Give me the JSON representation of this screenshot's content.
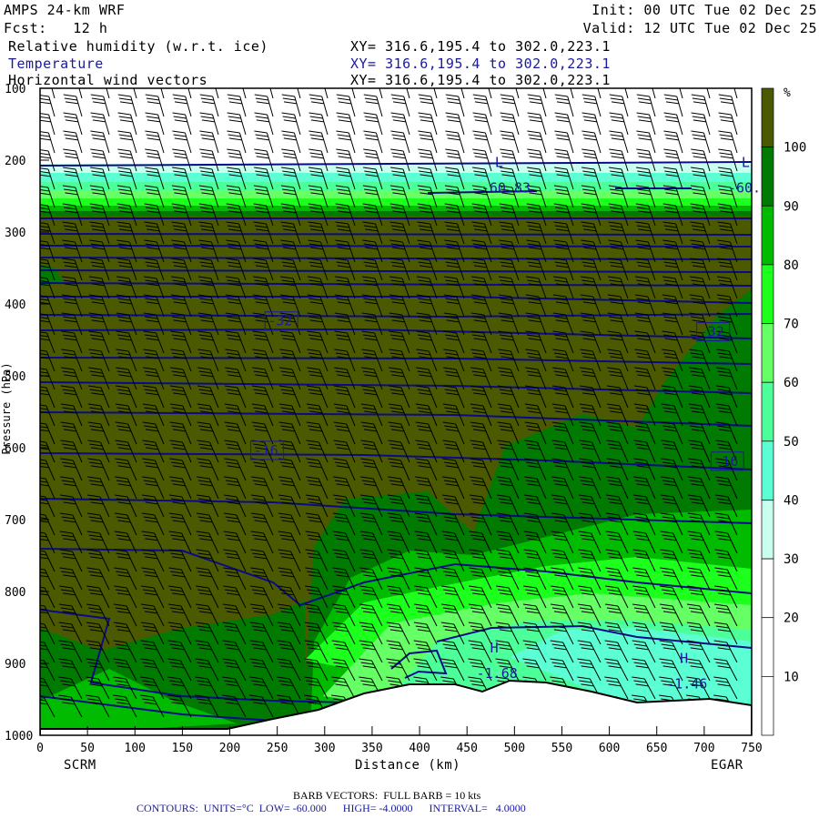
{
  "header": {
    "model": "AMPS 24-km WRF",
    "init": "Init: 00 UTC Tue 02 Dec 25",
    "fcst": "Fcst:   12 h",
    "valid": "Valid: 12 UTC Tue 02 Dec 25",
    "fields": [
      {
        "name": "Relative humidity (w.r.t. ice)",
        "xy": "XY= 316.6,195.4 to 302.0,223.1",
        "color": "#000000"
      },
      {
        "name": "Temperature",
        "xy": "XY= 316.6,195.4 to 302.0,223.1",
        "color": "#1a1a9a"
      },
      {
        "name": "Horizontal wind vectors",
        "xy": "XY= 316.6,195.4 to 302.0,223.1",
        "color": "#000000"
      }
    ]
  },
  "footer": {
    "barb": "BARB VECTORS:  FULL BARB = 10 kts",
    "contours": "CONTOURS:  UNITS=°C  LOW= -60.000      HIGH= -4.0000      INTERVAL=   4.0000"
  },
  "chart_data": {
    "type": "heatmap",
    "title": "Cross-section: RH (ice), Temperature, Wind",
    "xlabel": "Distance (km)",
    "ylabel": "Pressure (hPa)",
    "x_ticks": [
      "0",
      "50",
      "100",
      "150",
      "200",
      "250",
      "300",
      "350",
      "400",
      "450",
      "500",
      "550",
      "600",
      "650",
      "700",
      "750"
    ],
    "xlim": [
      0,
      750
    ],
    "y_ticks": [
      "100",
      "200",
      "300",
      "400",
      "500",
      "600",
      "700",
      "800",
      "900",
      "1000"
    ],
    "ylim": [
      1000,
      100
    ],
    "endpoints": {
      "left": "SCRM",
      "right": "EGAR"
    },
    "colorbar": {
      "unit": "%",
      "labels": [
        "100",
        "90",
        "80",
        "70",
        "60",
        "50",
        "40",
        "30",
        "20",
        "10"
      ],
      "bins": [
        {
          "range": ">100",
          "color": "#4b5a00"
        },
        {
          "range": "90-100",
          "color": "#007a00"
        },
        {
          "range": "80-90",
          "color": "#00bb00"
        },
        {
          "range": "70-80",
          "color": "#1dff1d"
        },
        {
          "range": "60-70",
          "color": "#66ff66"
        },
        {
          "range": "50-60",
          "color": "#4dff99"
        },
        {
          "range": "40-50",
          "color": "#5cffd4"
        },
        {
          "range": "30-40",
          "color": "#c8ffee"
        },
        {
          "range": "20-30",
          "color": "#ffffff"
        },
        {
          "range": "10-20",
          "color": "#ffffff"
        },
        {
          "range": "<10",
          "color": "#ffffff"
        }
      ]
    },
    "contour_labels": [
      {
        "text": "L",
        "value": "-60.83",
        "km": 465,
        "p": 245
      },
      {
        "text": "L",
        "value": "-60.8",
        "km": 725,
        "p": 245
      },
      {
        "text": "-32",
        "km": 240,
        "p": 430
      },
      {
        "text": "-32",
        "km": 695,
        "p": 445
      },
      {
        "text": "-16",
        "km": 225,
        "p": 610
      },
      {
        "text": "-16",
        "km": 710,
        "p": 625
      },
      {
        "text": "H",
        "value": "-1.68",
        "km": 460,
        "p": 920
      },
      {
        "text": "H",
        "value": "-1.46",
        "km": 660,
        "p": 935
      }
    ]
  }
}
